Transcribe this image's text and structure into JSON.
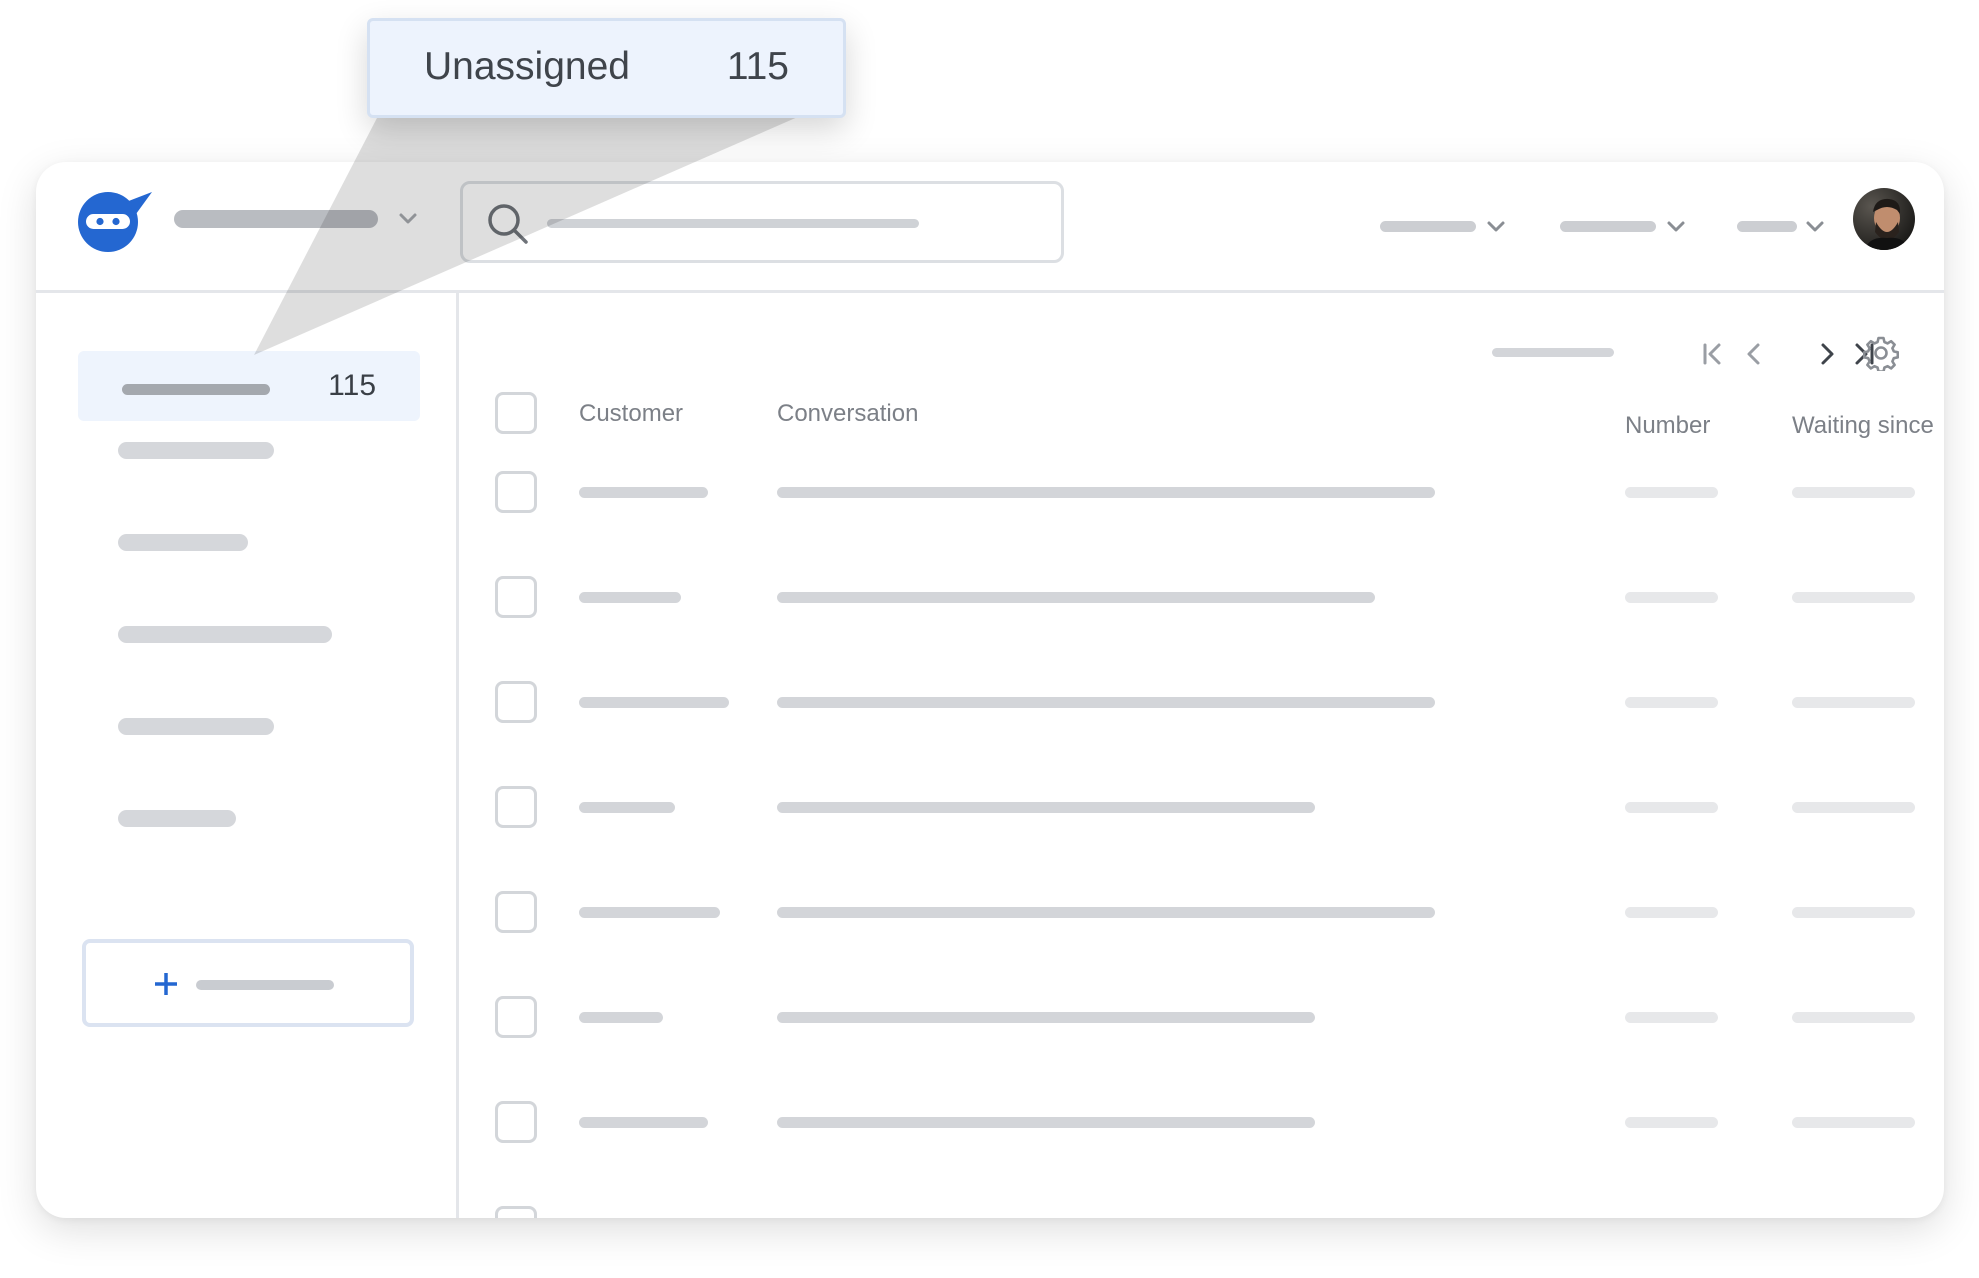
{
  "tooltip": {
    "label": "Unassigned",
    "count": "115"
  },
  "sidebar": {
    "active_item": {
      "count": "115"
    }
  },
  "table": {
    "columns": {
      "customer": "Customer",
      "conversation": "Conversation",
      "number": "Number",
      "waiting_since": "Waiting since"
    }
  },
  "icons": {
    "logo": "ninja-bot-logo",
    "search": "search-icon",
    "settings": "gear-icon",
    "pager": [
      "first-page-icon",
      "prev-page-icon",
      "next-page-icon",
      "last-page-icon"
    ]
  },
  "colors": {
    "brand": "#2467d1",
    "active_item_bg": "#eef4fd",
    "tooltip_bg": "#edf3fd"
  }
}
